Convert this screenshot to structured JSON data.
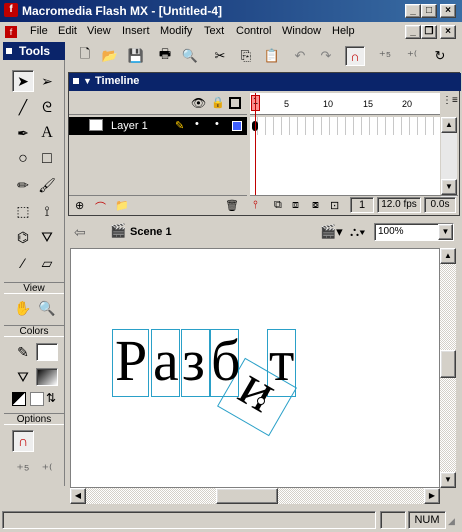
{
  "window": {
    "title": "Macromedia Flash MX - [Untitled-4]"
  },
  "menu": [
    "File",
    "Edit",
    "View",
    "Insert",
    "Modify",
    "Text",
    "Control",
    "Window",
    "Help"
  ],
  "tools": {
    "header": "Tools",
    "view_label": "View",
    "colors_label": "Colors",
    "options_label": "Options"
  },
  "timeline": {
    "header": "Timeline",
    "layer_name": "Layer 1",
    "frame_ruler": [
      "1",
      "5",
      "10",
      "15",
      "20"
    ],
    "current_frame": "1",
    "fps": "12.0 fps",
    "time": "0.0s"
  },
  "editbar": {
    "scene": "Scene 1",
    "zoom": "100%"
  },
  "stage": {
    "letters": [
      "Р",
      "а",
      "з",
      "б",
      "и",
      "т"
    ]
  },
  "status": {
    "num": "NUM"
  },
  "colors": {
    "accent": "#0a246a",
    "selection": "#2aa0c8",
    "layer_color": "#4060ff"
  }
}
